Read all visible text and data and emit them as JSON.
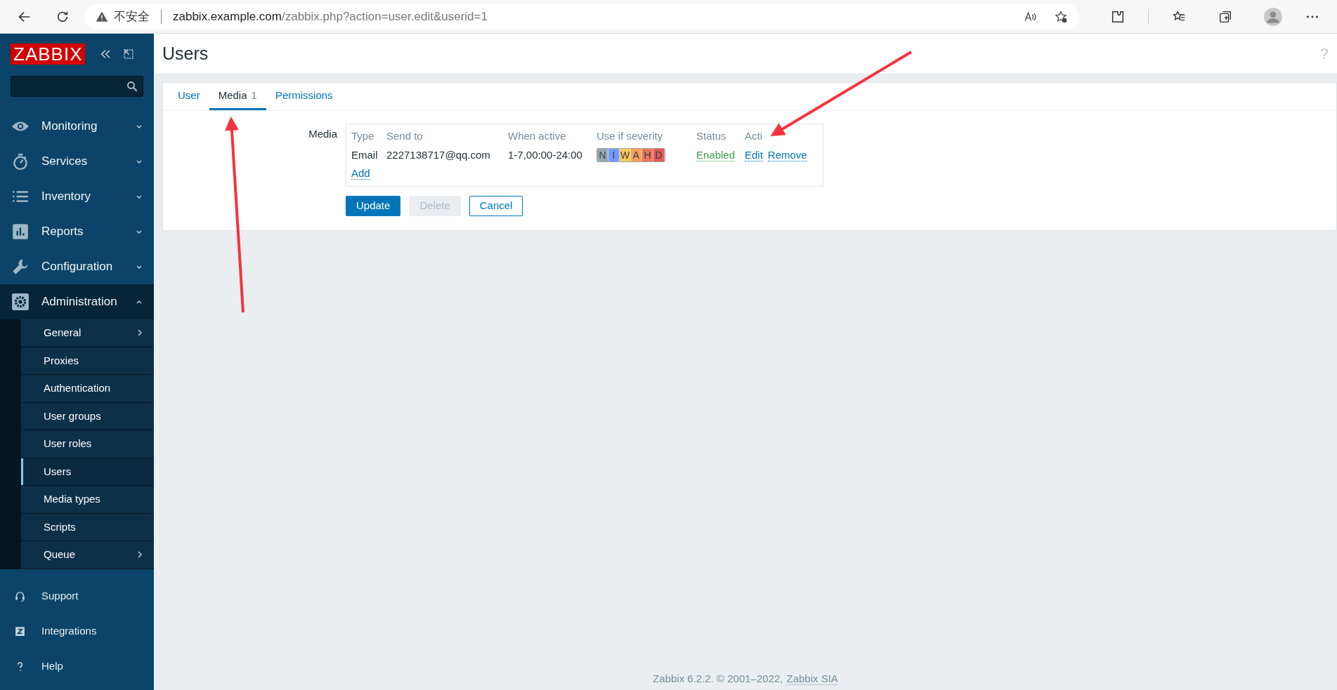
{
  "browser": {
    "insecure_label": "不安全",
    "url_host": "zabbix.example.com",
    "url_path": "/zabbix.php?action=user.edit&userid=1"
  },
  "sidebar": {
    "logo": "ZABBIX",
    "menu": [
      {
        "label": "Monitoring",
        "expanded": false
      },
      {
        "label": "Services",
        "expanded": false
      },
      {
        "label": "Inventory",
        "expanded": false
      },
      {
        "label": "Reports",
        "expanded": false
      },
      {
        "label": "Configuration",
        "expanded": false
      },
      {
        "label": "Administration",
        "expanded": true,
        "children": [
          {
            "label": "General",
            "has_submenu": true,
            "selected": false
          },
          {
            "label": "Proxies",
            "has_submenu": false,
            "selected": false
          },
          {
            "label": "Authentication",
            "has_submenu": false,
            "selected": false
          },
          {
            "label": "User groups",
            "has_submenu": false,
            "selected": false
          },
          {
            "label": "User roles",
            "has_submenu": false,
            "selected": false
          },
          {
            "label": "Users",
            "has_submenu": false,
            "selected": true
          },
          {
            "label": "Media types",
            "has_submenu": false,
            "selected": false
          },
          {
            "label": "Scripts",
            "has_submenu": false,
            "selected": false
          },
          {
            "label": "Queue",
            "has_submenu": true,
            "selected": false
          }
        ]
      }
    ],
    "bottom": [
      {
        "label": "Support"
      },
      {
        "label": "Integrations"
      },
      {
        "label": "Help"
      }
    ]
  },
  "page": {
    "title": "Users",
    "help": "?"
  },
  "tabs": [
    {
      "label": "User",
      "selected": false
    },
    {
      "label": "Media",
      "count": "1",
      "selected": true
    },
    {
      "label": "Permissions",
      "selected": false
    }
  ],
  "form": {
    "label": "Media",
    "columns": [
      "Type",
      "Send to",
      "When active",
      "Use if severity",
      "Status",
      "Acti"
    ],
    "rows": [
      {
        "type": "Email",
        "send_to": "2227138717@qq.com",
        "when_active": "1-7,00:00-24:00",
        "severities": [
          {
            "letter": "N",
            "color": "#97aab3"
          },
          {
            "letter": "I",
            "color": "#7499ff"
          },
          {
            "letter": "W",
            "color": "#ffc859"
          },
          {
            "letter": "A",
            "color": "#ffa059"
          },
          {
            "letter": "H",
            "color": "#e97659"
          },
          {
            "letter": "D",
            "color": "#e45959"
          }
        ],
        "status": "Enabled",
        "actions": [
          "Edit",
          "Remove"
        ]
      }
    ],
    "add_link": "Add",
    "buttons": [
      {
        "label": "Update",
        "kind": "primary"
      },
      {
        "label": "Delete",
        "kind": "disabled"
      },
      {
        "label": "Cancel",
        "kind": "secondary"
      }
    ]
  },
  "footer": {
    "text": "Zabbix 6.2.2. © 2001–2022,",
    "link": "Zabbix SIA"
  }
}
